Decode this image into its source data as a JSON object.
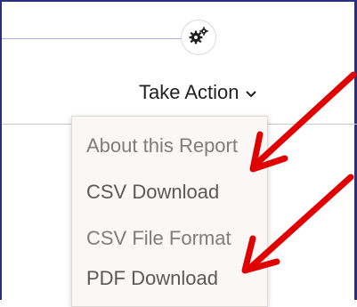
{
  "header": {
    "settings_icon": "gear-icon",
    "take_action_label": "Take Action",
    "take_action_icon": "chevron-down-icon"
  },
  "menu": {
    "items": [
      {
        "label": "About this Report",
        "color": "#7d7d7d"
      },
      {
        "label": "CSV Download",
        "color": "#595959"
      },
      {
        "label": "CSV File Format",
        "color": "#7d7d7d"
      },
      {
        "label": "PDF Download",
        "color": "#595959"
      }
    ]
  },
  "annotations": {
    "arrow_color": "#e00000",
    "arrow_targets": [
      "CSV Download",
      "PDF Download"
    ]
  },
  "colors": {
    "frame_border": "#2b2f7a",
    "top_line": "#a7b2e2",
    "menu_bg": "#fbf7f6"
  }
}
